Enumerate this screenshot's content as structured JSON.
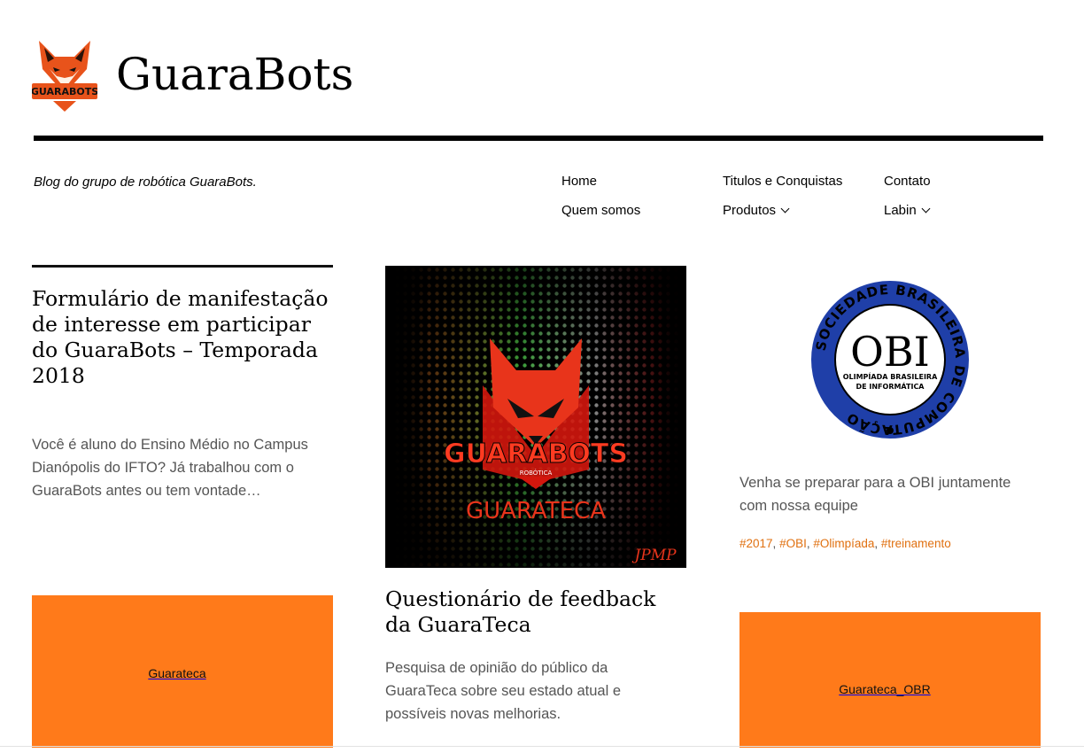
{
  "site": {
    "title": "GuaraBots",
    "tagline": "Blog do grupo de robótica GuaraBots.",
    "logo_text": "GUARABOTS",
    "accent": "#ff7a1a"
  },
  "nav": {
    "home": "Home",
    "titulos": "Titulos e Conquistas",
    "contato": "Contato",
    "quem_somos": "Quem somos",
    "produtos": "Produtos",
    "labin": "Labin"
  },
  "posts": {
    "p1": {
      "title": "Formulário de manifestação de interesse em participar do GuaraBots – Temporada 2018",
      "excerpt": "Você é aluno do Ensino Médio no Campus Dianópolis do IFTO? Já trabalhou com o GuaraBots antes ou tem vontade…"
    },
    "p2": {
      "image_brand": "GUARABOTS",
      "image_sub": "ROBÓTICA",
      "image_name": "GUARATECA",
      "image_signature": "JPMP",
      "title": "Questionário de feedback da GuaraTeca",
      "excerpt": "Pesquisa de opinião do público da GuaraTeca sobre seu estado atual e possíveis novas melhorias."
    },
    "p3": {
      "badge_acronym": "OBI",
      "badge_ring": "SOCIEDADE BRASILEIRA DE COMPUTAÇÃO",
      "badge_line1": "OLIMPÍADA BRASILEIRA",
      "badge_line2": "DE INFORMÁTICA",
      "excerpt": "Venha se preparar para a OBI juntamente com nossa equipe",
      "tags": [
        "#2017",
        "#OBI",
        "#Olimpíada",
        "#treinamento"
      ]
    },
    "p4": {
      "thumb_label": "Guarateca"
    },
    "p5": {
      "thumb_label": "Guarateca_OBR"
    }
  }
}
